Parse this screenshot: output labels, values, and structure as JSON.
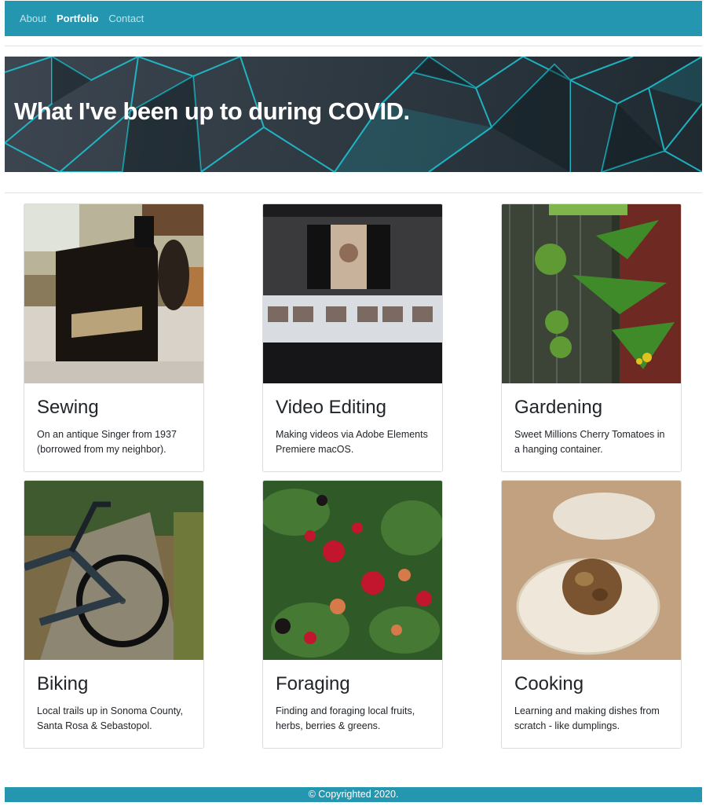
{
  "nav": {
    "items": [
      {
        "label": "About"
      },
      {
        "label": "Portfolio"
      },
      {
        "label": "Contact"
      }
    ]
  },
  "hero": {
    "title": "What I've been up to during COVID."
  },
  "cards": [
    {
      "title": "Sewing",
      "text": "On an antique Singer from 1937 (borrowed from my neighbor)."
    },
    {
      "title": "Video Editing",
      "text": "Making videos via Adobe Elements Premiere macOS."
    },
    {
      "title": "Gardening",
      "text": "Sweet Millions Cherry Tomatoes in a hanging container."
    },
    {
      "title": "Biking",
      "text": "Local trails up in Sonoma County, Santa Rosa & Sebastopol."
    },
    {
      "title": "Foraging",
      "text": "Finding and foraging local fruits, herbs, berries & greens."
    },
    {
      "title": "Cooking",
      "text": "Learning and making dishes from scratch - like dumplings."
    }
  ],
  "footer": {
    "text": "© Copyrighted 2020."
  },
  "colors": {
    "navbar": "#2596b0",
    "footer": "#2596b0",
    "hero_accent": "#1ec8d8"
  }
}
